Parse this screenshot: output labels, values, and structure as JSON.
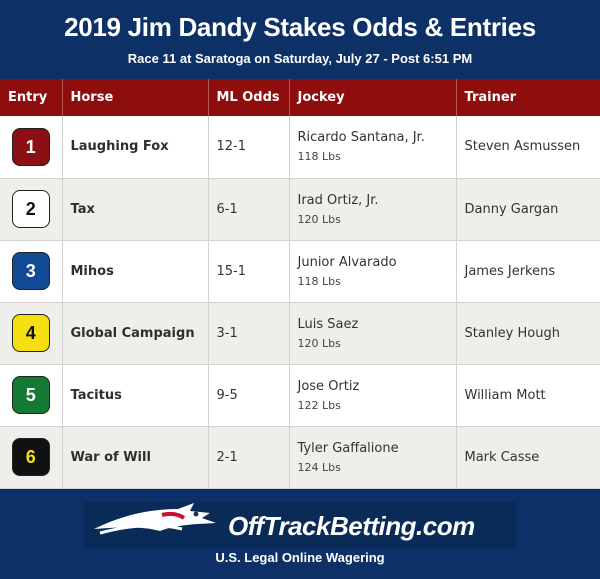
{
  "header": {
    "title": "2019 Jim Dandy Stakes Odds & Entries",
    "subtitle": "Race 11 at Saratoga on Saturday, July 27 - Post 6:51 PM"
  },
  "table": {
    "columns": [
      "Entry",
      "Horse",
      "ML Odds",
      "Jockey",
      "Trainer"
    ],
    "rows": [
      {
        "entry": "1",
        "horse": "Laughing Fox",
        "odds": "12-1",
        "jockey": "Ricardo Santana, Jr.",
        "weight": "118 Lbs",
        "trainer": "Steven Asmussen",
        "badge_bg": "#8b0f14",
        "badge_fg": "#ffffff"
      },
      {
        "entry": "2",
        "horse": "Tax",
        "odds": "6-1",
        "jockey": "Irad Ortiz, Jr.",
        "weight": "120 Lbs",
        "trainer": "Danny Gargan",
        "badge_bg": "#ffffff",
        "badge_fg": "#111111"
      },
      {
        "entry": "3",
        "horse": "Mihos",
        "odds": "15-1",
        "jockey": "Junior Alvarado",
        "weight": "118 Lbs",
        "trainer": "James Jerkens",
        "badge_bg": "#124a96",
        "badge_fg": "#ffffff"
      },
      {
        "entry": "4",
        "horse": "Global Campaign",
        "odds": "3-1",
        "jockey": "Luis Saez",
        "weight": "120 Lbs",
        "trainer": "Stanley Hough",
        "badge_bg": "#f5df12",
        "badge_fg": "#111111"
      },
      {
        "entry": "5",
        "horse": "Tacitus",
        "odds": "9-5",
        "jockey": "Jose Ortiz",
        "weight": "122 Lbs",
        "trainer": "William Mott",
        "badge_bg": "#127a33",
        "badge_fg": "#ffffff"
      },
      {
        "entry": "6",
        "horse": "War of Will",
        "odds": "2-1",
        "jockey": "Tyler Gaffalione",
        "weight": "124 Lbs",
        "trainer": "Mark Casse",
        "badge_bg": "#111111",
        "badge_fg": "#f5df12"
      }
    ]
  },
  "footer": {
    "logo_text": "OffTrackBetting.com",
    "tagline": "U.S. Legal Online Wagering"
  },
  "colors": {
    "header_bg": "#0d3166",
    "table_header_bg": "#8e0e0e",
    "row_alt_bg": "#eeeeea"
  }
}
